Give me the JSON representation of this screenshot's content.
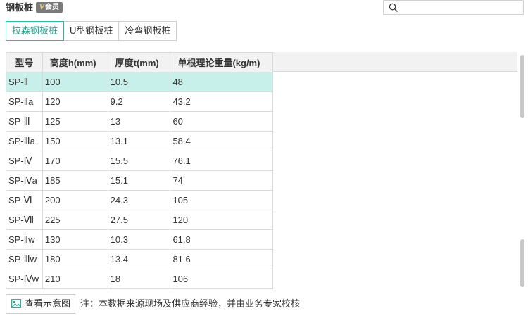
{
  "header": {
    "title": "钢板桩",
    "vip_badge": "会员",
    "vip_badge_mark": "V"
  },
  "search": {
    "value": "",
    "placeholder": ""
  },
  "tabs": [
    {
      "label": "拉森钢板桩",
      "active": true
    },
    {
      "label": "U型钢板桩",
      "active": false
    },
    {
      "label": "冷弯钢板桩",
      "active": false
    }
  ],
  "table": {
    "columns": [
      "型号",
      "高度h(mm)",
      "厚度t(mm)",
      "单根理论重量(kg/m)"
    ],
    "rows": [
      [
        "SP-Ⅱ",
        "100",
        "10.5",
        "48"
      ],
      [
        "SP-Ⅱa",
        "120",
        "9.2",
        "43.2"
      ],
      [
        "SP-Ⅲ",
        "125",
        "13",
        "60"
      ],
      [
        "SP-Ⅲa",
        "150",
        "13.1",
        "58.4"
      ],
      [
        "SP-Ⅳ",
        "170",
        "15.5",
        "76.1"
      ],
      [
        "SP-Ⅳa",
        "185",
        "15.1",
        "74"
      ],
      [
        "SP-Ⅵ",
        "200",
        "24.3",
        "105"
      ],
      [
        "SP-Ⅶ",
        "225",
        "27.5",
        "120"
      ],
      [
        "SP-Ⅱw",
        "130",
        "10.3",
        "61.8"
      ],
      [
        "SP-Ⅲw",
        "180",
        "13.4",
        "81.6"
      ],
      [
        "SP-Ⅳw",
        "210",
        "18",
        "106"
      ]
    ],
    "selected_row": 0
  },
  "footer": {
    "view_button": "查看示意图",
    "note": "注：本数据来源现场及供应商经验，并由业务专家校核"
  },
  "colors": {
    "accent": "#1aa58e",
    "selected_row": "#c8f0ea",
    "header_bg": "#f2f2f2"
  },
  "icons": {
    "search": "search-icon",
    "image": "image-icon"
  }
}
